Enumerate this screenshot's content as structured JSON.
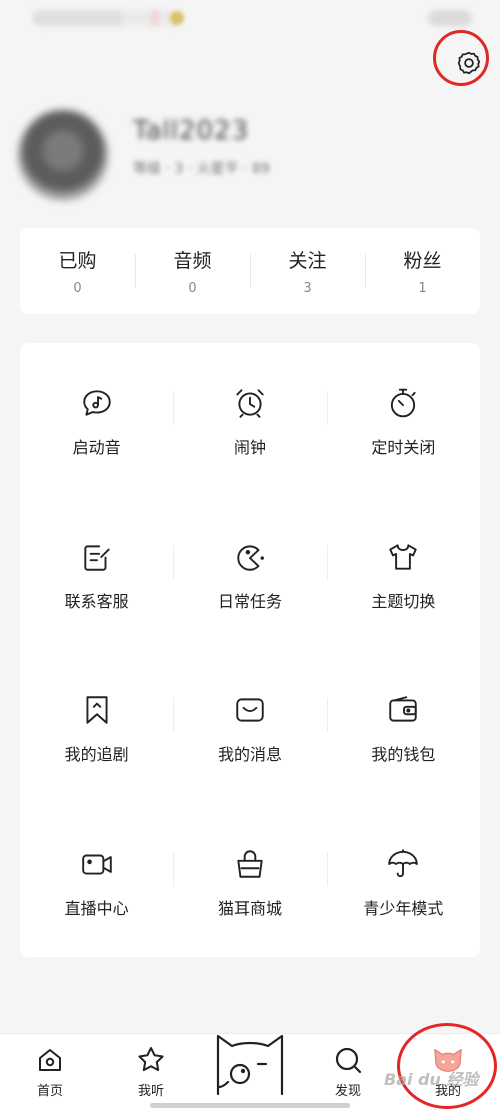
{
  "profile": {
    "username": "Tall2023",
    "meta": "等级 · 3 · 火星平 · 89"
  },
  "stats": [
    {
      "label": "已购",
      "value": "0"
    },
    {
      "label": "音频",
      "value": "0"
    },
    {
      "label": "关注",
      "value": "3"
    },
    {
      "label": "粉丝",
      "value": "1"
    }
  ],
  "menu": [
    {
      "label": "启动音",
      "icon": "sound-bubble-icon"
    },
    {
      "label": "闹钟",
      "icon": "alarm-clock-icon"
    },
    {
      "label": "定时关闭",
      "icon": "stopwatch-icon"
    },
    {
      "label": "联系客服",
      "icon": "edit-note-icon"
    },
    {
      "label": "日常任务",
      "icon": "pacman-icon"
    },
    {
      "label": "主题切换",
      "icon": "tshirt-icon"
    },
    {
      "label": "我的追剧",
      "icon": "bookmark-icon"
    },
    {
      "label": "我的消息",
      "icon": "message-icon"
    },
    {
      "label": "我的钱包",
      "icon": "wallet-icon"
    },
    {
      "label": "直播中心",
      "icon": "video-camera-icon"
    },
    {
      "label": "猫耳商城",
      "icon": "shopping-bag-icon"
    },
    {
      "label": "青少年模式",
      "icon": "umbrella-icon"
    }
  ],
  "nav": {
    "home": "首页",
    "listen": "我听",
    "discover": "发现",
    "mine": "我的"
  },
  "watermark": "Bai du 经验",
  "colors": {
    "highlight": "#e32626",
    "accent": "#f5a59a",
    "background": "#f5f5f5"
  }
}
